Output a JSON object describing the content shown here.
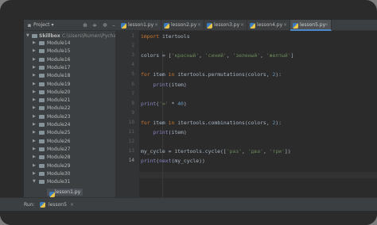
{
  "toolbar": {
    "project_label": "Project",
    "tabs": [
      {
        "label": "lesson1.py"
      },
      {
        "label": "lesson2.py"
      },
      {
        "label": "lesson3.py"
      },
      {
        "label": "lesson4.py"
      },
      {
        "label": "lesson5.py"
      }
    ],
    "icons": [
      "globe-icon",
      "collapse-icon",
      "gear-icon",
      "minimize-icon"
    ]
  },
  "project": {
    "root_label": "Skillbox",
    "root_path": "C:\\Users\\Rumen\\Pycharm",
    "modules": [
      "Module14",
      "Module15",
      "Module16",
      "Module17",
      "Module18",
      "Module19",
      "Module20",
      "Module21",
      "Module22",
      "Module23",
      "Module24",
      "Module25",
      "Module26",
      "Module27",
      "Module28",
      "Module29",
      "Module30",
      "Module31"
    ],
    "open_file": "lesson1.py"
  },
  "editor": {
    "line_numbers": [
      "1",
      "2",
      "3",
      "4",
      "5",
      "6",
      "7",
      "8",
      "9",
      "10",
      "11",
      "12",
      "13",
      "14"
    ],
    "lines": [
      "import itertools",
      "",
      "colors = ['красный', 'синий', 'зеленый', 'желтый']",
      "",
      "for item in itertools.permutations(colors, 2):",
      "    print(item)",
      "",
      "print('=' * 40)",
      "",
      "for item in itertools.combinations(colors, 2):",
      "    print(item)",
      "",
      "my_cycle = itertools.cycle(['раз', 'два', 'три'])",
      "print(next(my_cycle))"
    ]
  },
  "status": {
    "run_label": "Run:",
    "run_config": "lesson5"
  }
}
